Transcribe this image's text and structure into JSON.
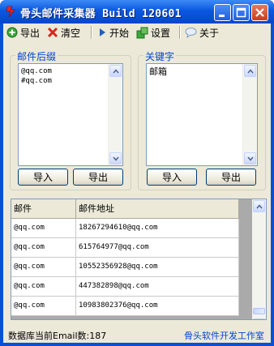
{
  "window": {
    "title": "骨头邮件采集器 Build 120601",
    "buttons": [
      "minimize",
      "maximize",
      "close"
    ]
  },
  "toolbar": {
    "items": [
      {
        "label": "导出",
        "icon": "green-plus-circle-icon"
      },
      {
        "label": "清空",
        "icon": "red-x-icon"
      },
      {
        "label": "开始",
        "icon": "blue-play-icon"
      },
      {
        "label": "设置",
        "icon": "puzzle-icon"
      },
      {
        "label": "关于",
        "icon": "speech-bubble-icon"
      }
    ]
  },
  "suffix_panel": {
    "label": "邮件后缀",
    "lines": [
      "@qq.com",
      "#qq.com"
    ],
    "import_label": "导入",
    "export_label": "导出"
  },
  "keyword_panel": {
    "label": "关键字",
    "lines": [
      "邮箱"
    ],
    "import_label": "导入",
    "export_label": "导出"
  },
  "results": {
    "columns": [
      "邮件",
      "邮件地址"
    ],
    "rows": [
      [
        "@qq.com",
        "18267294610@qq.com"
      ],
      [
        "@qq.com",
        "615764977@qq.com"
      ],
      [
        "@qq.com",
        "10552356928@qq.com"
      ],
      [
        "@qq.com",
        "447382898@qq.com"
      ],
      [
        "@qq.com",
        "10983802376@qq.com"
      ]
    ]
  },
  "status": {
    "left": "数据库当前Email数:187",
    "right": "骨头软件开发工作室"
  },
  "colors": {
    "titlebar": "#0a58e0",
    "client": "#ece9d8",
    "group_label": "#0046d5"
  }
}
